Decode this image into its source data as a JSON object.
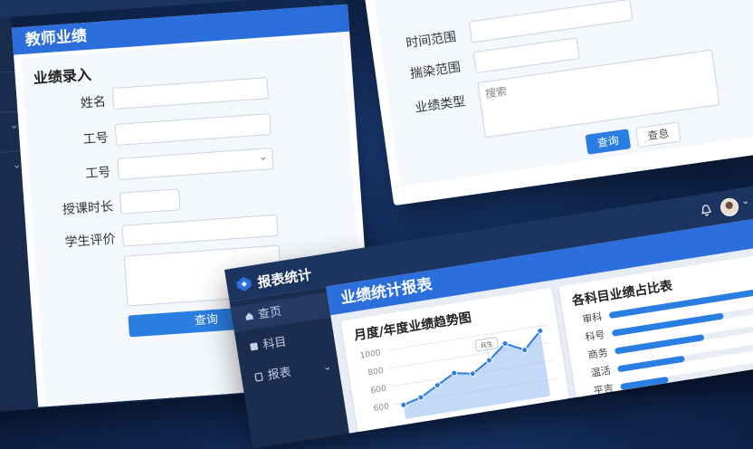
{
  "left_panel": {
    "title": "教师业绩",
    "section_title": "业绩录入",
    "fields": [
      {
        "label": "姓名",
        "value": ""
      },
      {
        "label": "工号",
        "value": ""
      },
      {
        "label": "工号",
        "value": "",
        "type": "select"
      },
      {
        "label": "授课时长",
        "value": ""
      },
      {
        "label": "学生评价",
        "value": ""
      }
    ],
    "query_button": "查询"
  },
  "right_top_panel": {
    "fields": [
      {
        "label": "时间范围",
        "value": ""
      },
      {
        "label": "揣染范围",
        "value": ""
      },
      {
        "label": "业绩类型",
        "placeholder": "搜索"
      }
    ],
    "query_button": "查询",
    "reset_button": "查息"
  },
  "report_panel": {
    "app_name": "报表统计",
    "header_title": "业绩统计报表",
    "nav": [
      {
        "label": "查页",
        "icon": "home-icon"
      },
      {
        "label": "科目",
        "icon": "book-icon"
      },
      {
        "label": "报表",
        "icon": "report-icon"
      }
    ],
    "line_chart_title": "月度/年度业绩趋势图",
    "bar_chart_title": "各科目业绩占比表"
  },
  "chart_data": [
    {
      "type": "area",
      "title": "月度/年度业绩趋势图",
      "y_ticks": [
        "1000",
        "800",
        "600",
        "600"
      ],
      "ylim": [
        400,
        1000
      ],
      "values": [
        520,
        560,
        640,
        720,
        690,
        780,
        900,
        820,
        960
      ],
      "annotation": "兵生"
    },
    {
      "type": "bar",
      "title": "各科目业绩占比表",
      "categories": [
        "审科",
        "科号",
        "商务",
        "温活",
        "平吉"
      ],
      "values": [
        0.92,
        0.7,
        0.56,
        0.42,
        0.3
      ]
    }
  ],
  "colors": {
    "accent": "#2c6fdc",
    "sidebar": "#1b2d4f",
    "bar": "#2a7de1"
  }
}
